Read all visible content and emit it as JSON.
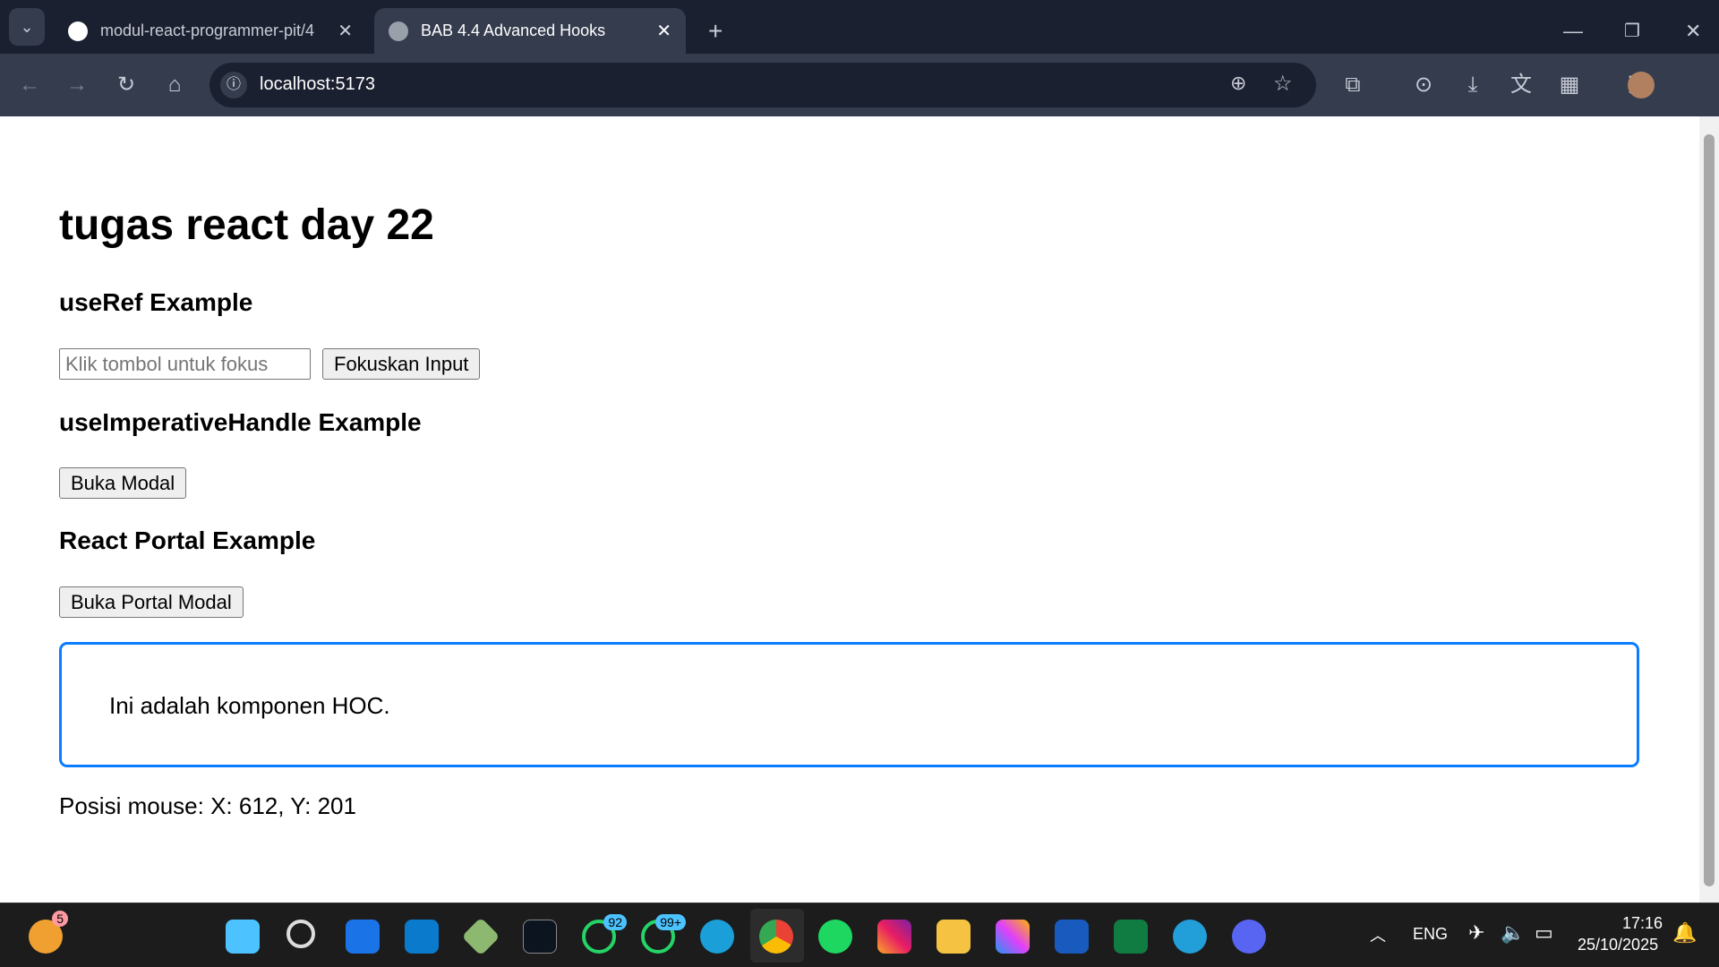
{
  "browser": {
    "tabs": [
      {
        "title": "modul-react-programmer-pit/4",
        "icon": "github-icon",
        "active": false
      },
      {
        "title": "BAB 4.4 Advanced Hooks",
        "icon": "globe-icon",
        "active": true
      }
    ],
    "url": "localhost:5173"
  },
  "page": {
    "title": "tugas react day 22",
    "sections": [
      {
        "heading": "useRef Example",
        "input_placeholder": "Klik tombol untuk fokus",
        "button": "Fokuskan Input"
      },
      {
        "heading": "useImperativeHandle Example",
        "button": "Buka Modal"
      },
      {
        "heading": "React Portal Example",
        "button": "Buka Portal Modal"
      }
    ],
    "hoc_text": "Ini adalah komponen HOC.",
    "hoc_border_color": "#0a7cff",
    "mouse_position": "Posisi mouse: X: 612, Y: 201"
  },
  "taskbar": {
    "weather_badge": "5",
    "whatsapp_badge": "92",
    "whatsapp_business_badge": "99+",
    "language": "ENG",
    "time": "17:16",
    "date": "25/10/2025"
  }
}
